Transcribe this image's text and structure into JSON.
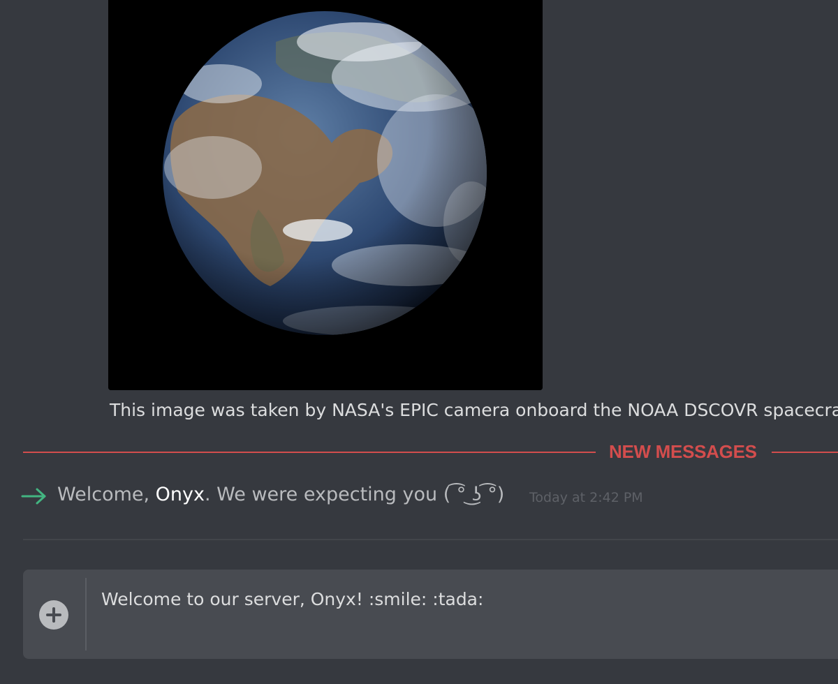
{
  "attachment": {
    "icon": "earth-photo",
    "caption": "This image was taken by NASA's EPIC camera onboard the NOAA DSCOVR spacecraft"
  },
  "divider": {
    "label": "NEW MESSAGES",
    "color": "#d34d4d"
  },
  "join_message": {
    "icon": "arrow-right-icon",
    "prefix": "Welcome, ",
    "username": "Onyx",
    "suffix": ". We were expecting you ( ͡° ͜ʖ ͡°)",
    "timestamp": "Today at 2:42 PM"
  },
  "composer": {
    "upload_icon": "plus-circle-icon",
    "value": "Welcome to our server, Onyx! :smile: :tada:"
  },
  "colors": {
    "background": "#36393f",
    "composer": "#484b51",
    "join_arrow": "#43b581"
  }
}
